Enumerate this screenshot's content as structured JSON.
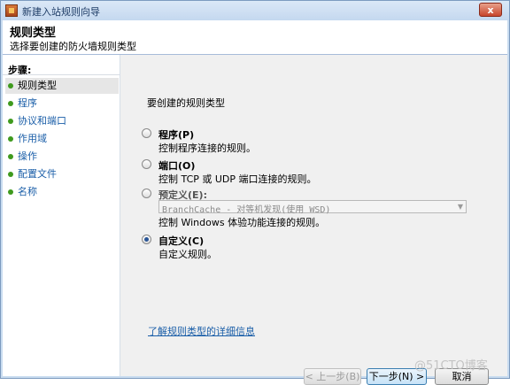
{
  "window": {
    "title": "新建入站规则向导",
    "close_label": "x"
  },
  "header": {
    "title": "规则类型",
    "subtitle": "选择要创建的防火墙规则类型"
  },
  "steps": {
    "label": "步骤:",
    "items": [
      {
        "label": "规则类型",
        "active": true
      },
      {
        "label": "程序",
        "active": false
      },
      {
        "label": "协议和端口",
        "active": false
      },
      {
        "label": "作用域",
        "active": false
      },
      {
        "label": "操作",
        "active": false
      },
      {
        "label": "配置文件",
        "active": false
      },
      {
        "label": "名称",
        "active": false
      }
    ]
  },
  "main": {
    "section_label": "要创建的规则类型",
    "options": [
      {
        "title": "程序(P)",
        "desc": "控制程序连接的规则。",
        "checked": false
      },
      {
        "title": "端口(O)",
        "desc": "控制 TCP 或 UDP 端口连接的规则。",
        "checked": false
      },
      {
        "title": "预定义(E):",
        "desc": "控制 Windows 体验功能连接的规则。",
        "checked": false
      },
      {
        "title": "自定义(C)",
        "desc": "自定义规则。",
        "checked": true
      }
    ],
    "predefined_select_value": "BranchCache - 对等机发现(使用 WSD)",
    "help_link": "了解规则类型的详细信息"
  },
  "buttons": {
    "back": "< 上一步(B)",
    "next": "下一步(N) >",
    "cancel": "取消"
  },
  "watermark": "@51CTO博客",
  "colors": {
    "step_dot": "#3f9a1d",
    "link": "#1a5ea8",
    "close_button": "#c7452c"
  }
}
